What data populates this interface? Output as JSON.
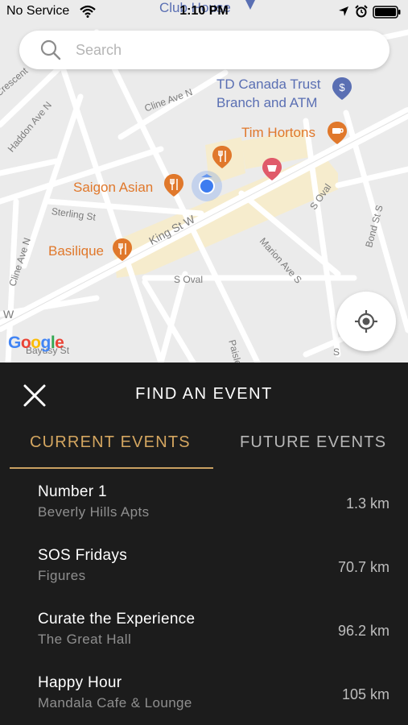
{
  "status_bar": {
    "carrier": "No Service",
    "time": "1:10 PM",
    "clubhouse": "Club House"
  },
  "search": {
    "placeholder": "Search"
  },
  "map": {
    "streets": {
      "crescent": "Crescent",
      "haddon": "Haddon Ave N",
      "cline_n": "Cline Ave N",
      "cline_w": "Cline Ave N",
      "sterling": "Sterling St",
      "king": "King St W",
      "s_oval_1": "S Oval",
      "s_oval_2": "S Oval",
      "marion": "Marion Ave S",
      "bond": "Bond St S",
      "paisley": "Paisley",
      "bayusy": "Bayusy St",
      "w": "W"
    },
    "pois": {
      "td_line1": "TD Canada Trust",
      "td_line2": "Branch and ATM",
      "tim": "Tim Hortons",
      "saigon": "Saigon Asian",
      "basilique": "Basilique"
    },
    "google_logo": [
      "G",
      "o",
      "o",
      "g",
      "l",
      "e"
    ],
    "colors": {
      "restaurant": "#e0782b",
      "bank": "#5a6fb3",
      "shopping": "#e05a6a",
      "location_dot": "#3d7cf0",
      "highlight_area": "#f6eccd"
    }
  },
  "panel": {
    "title": "FIND AN EVENT",
    "close_icon": "close-icon",
    "tabs": {
      "current": "CURRENT EVENTS",
      "future": "FUTURE EVENTS",
      "selected": "current"
    },
    "events": [
      {
        "name": "Number 1",
        "venue": "Beverly Hills Apts",
        "distance": "1.3 km"
      },
      {
        "name": "SOS Fridays",
        "venue": "Figures",
        "distance": "70.7 km"
      },
      {
        "name": "Curate the Experience",
        "venue": "The Great Hall",
        "distance": "96.2 km"
      },
      {
        "name": "Happy Hour",
        "venue": "Mandala Cafe & Lounge",
        "distance": "105 km"
      }
    ],
    "colors": {
      "accent": "#d4a660",
      "background": "#1c1c1c"
    }
  }
}
